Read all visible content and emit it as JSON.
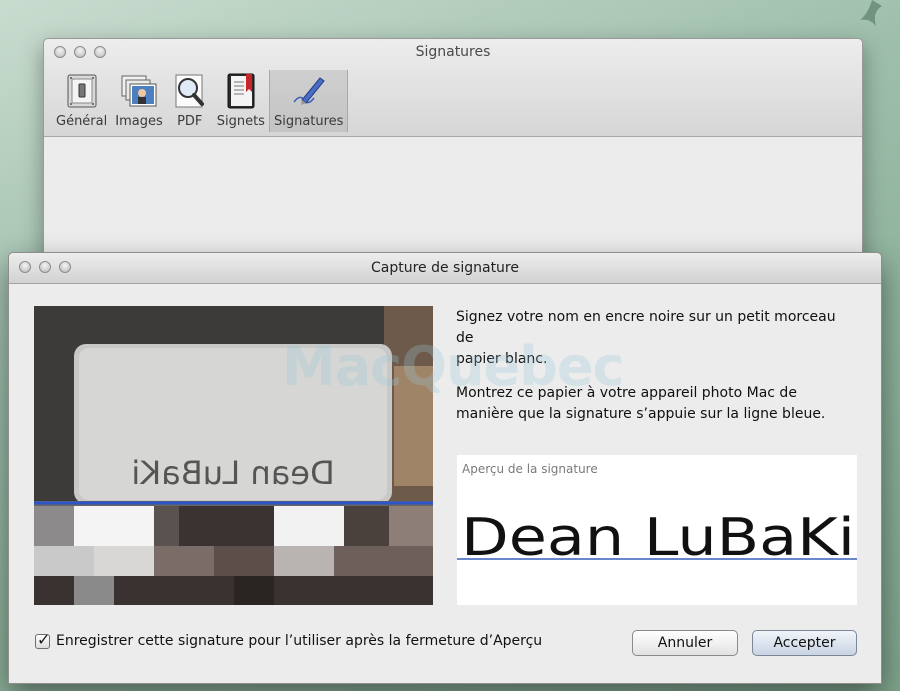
{
  "background": {
    "accent": "#8fb39d"
  },
  "pref_window": {
    "title": "Signatures",
    "toolbar": [
      {
        "label": "Général",
        "icon": "switch-icon",
        "selected": false
      },
      {
        "label": "Images",
        "icon": "images-icon",
        "selected": false
      },
      {
        "label": "PDF",
        "icon": "magnifier-icon",
        "selected": false
      },
      {
        "label": "Signets",
        "icon": "bookmark-icon",
        "selected": false
      },
      {
        "label": "Signatures",
        "icon": "pen-signature-icon",
        "selected": true
      }
    ]
  },
  "dialog": {
    "title": "Capture de signature",
    "camera_signature_text": "Dean LuBaKi",
    "instruction_1": "Signez votre nom en encre noire sur un petit morceau de\npapier blanc.",
    "instruction_2": "Montrez ce papier à votre appareil photo Mac de manière que la signature s’appuie sur la ligne bleue.",
    "preview_label": "Aperçu de la signature",
    "preview_signature_text": "Dean LuBaKi",
    "baseline_color": "#3a5fb8",
    "checkbox": {
      "checked": true,
      "label": "Enregistrer cette signature pour l’utiliser après la fermeture d’Aperçu"
    },
    "buttons": {
      "cancel": "Annuler",
      "accept": "Accepter"
    }
  },
  "watermark": "MacQuebec"
}
